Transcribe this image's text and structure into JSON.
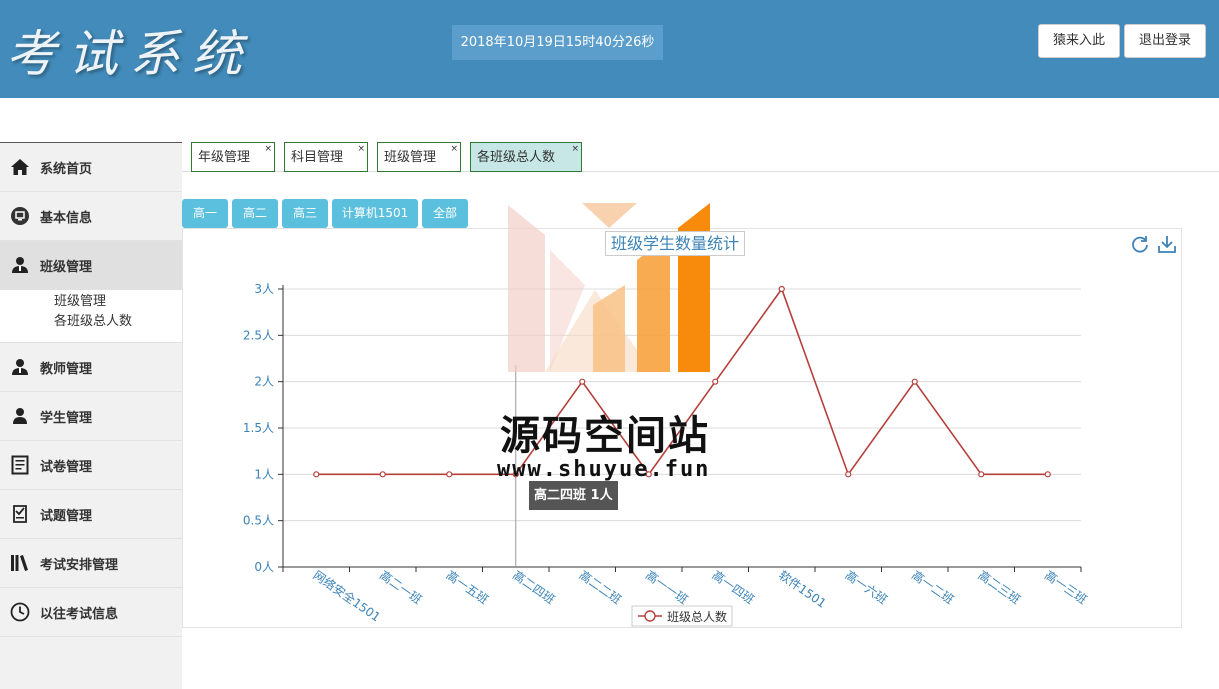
{
  "header": {
    "logo": "考试系统",
    "datetime": "2018年10月19日15时40分26秒",
    "buttons": [
      "猿来入此",
      "退出登录"
    ]
  },
  "sidebar": {
    "items": [
      {
        "label": "系统首页",
        "icon": "home-icon"
      },
      {
        "label": "基本信息",
        "icon": "info-icon"
      },
      {
        "label": "班级管理",
        "icon": "user-icon",
        "active": true,
        "children": [
          "班级管理",
          "各班级总人数"
        ]
      },
      {
        "label": "教师管理",
        "icon": "teacher-icon"
      },
      {
        "label": "学生管理",
        "icon": "student-icon"
      },
      {
        "label": "试卷管理",
        "icon": "document-icon"
      },
      {
        "label": "试题管理",
        "icon": "question-icon"
      },
      {
        "label": "考试安排管理",
        "icon": "books-icon"
      },
      {
        "label": "以往考试信息",
        "icon": "clock-icon"
      }
    ]
  },
  "tabs": [
    {
      "label": "年级管理"
    },
    {
      "label": "科目管理"
    },
    {
      "label": "班级管理"
    },
    {
      "label": "各班级总人数",
      "active": true
    }
  ],
  "grade_buttons": [
    "高一",
    "高二",
    "高三",
    "计算机1501",
    "全部"
  ],
  "watermark": {
    "title": "源码空间站",
    "url": "www.shuyue.fun"
  },
  "tooltip": "高二四班 1人",
  "chart_data": {
    "type": "line",
    "title": "班级学生数量统计",
    "categories": [
      "网络安全1501",
      "高二一班",
      "高一五班",
      "高二四班",
      "高二二班",
      "高一一班",
      "高一四班",
      "软件1501",
      "高一六班",
      "高一二班",
      "高二三班",
      "高一三班"
    ],
    "series": [
      {
        "name": "班级总人数",
        "values": [
          1,
          1,
          1,
          1,
          2,
          1,
          2,
          3,
          1,
          2,
          1,
          1
        ],
        "color": "#b5403b"
      }
    ],
    "y_ticks": [
      "0人",
      "0.5人",
      "1人",
      "1.5人",
      "2人",
      "2.5人",
      "3人"
    ],
    "ylim": [
      0,
      3
    ],
    "grid": true,
    "legend": "bottom-center"
  }
}
